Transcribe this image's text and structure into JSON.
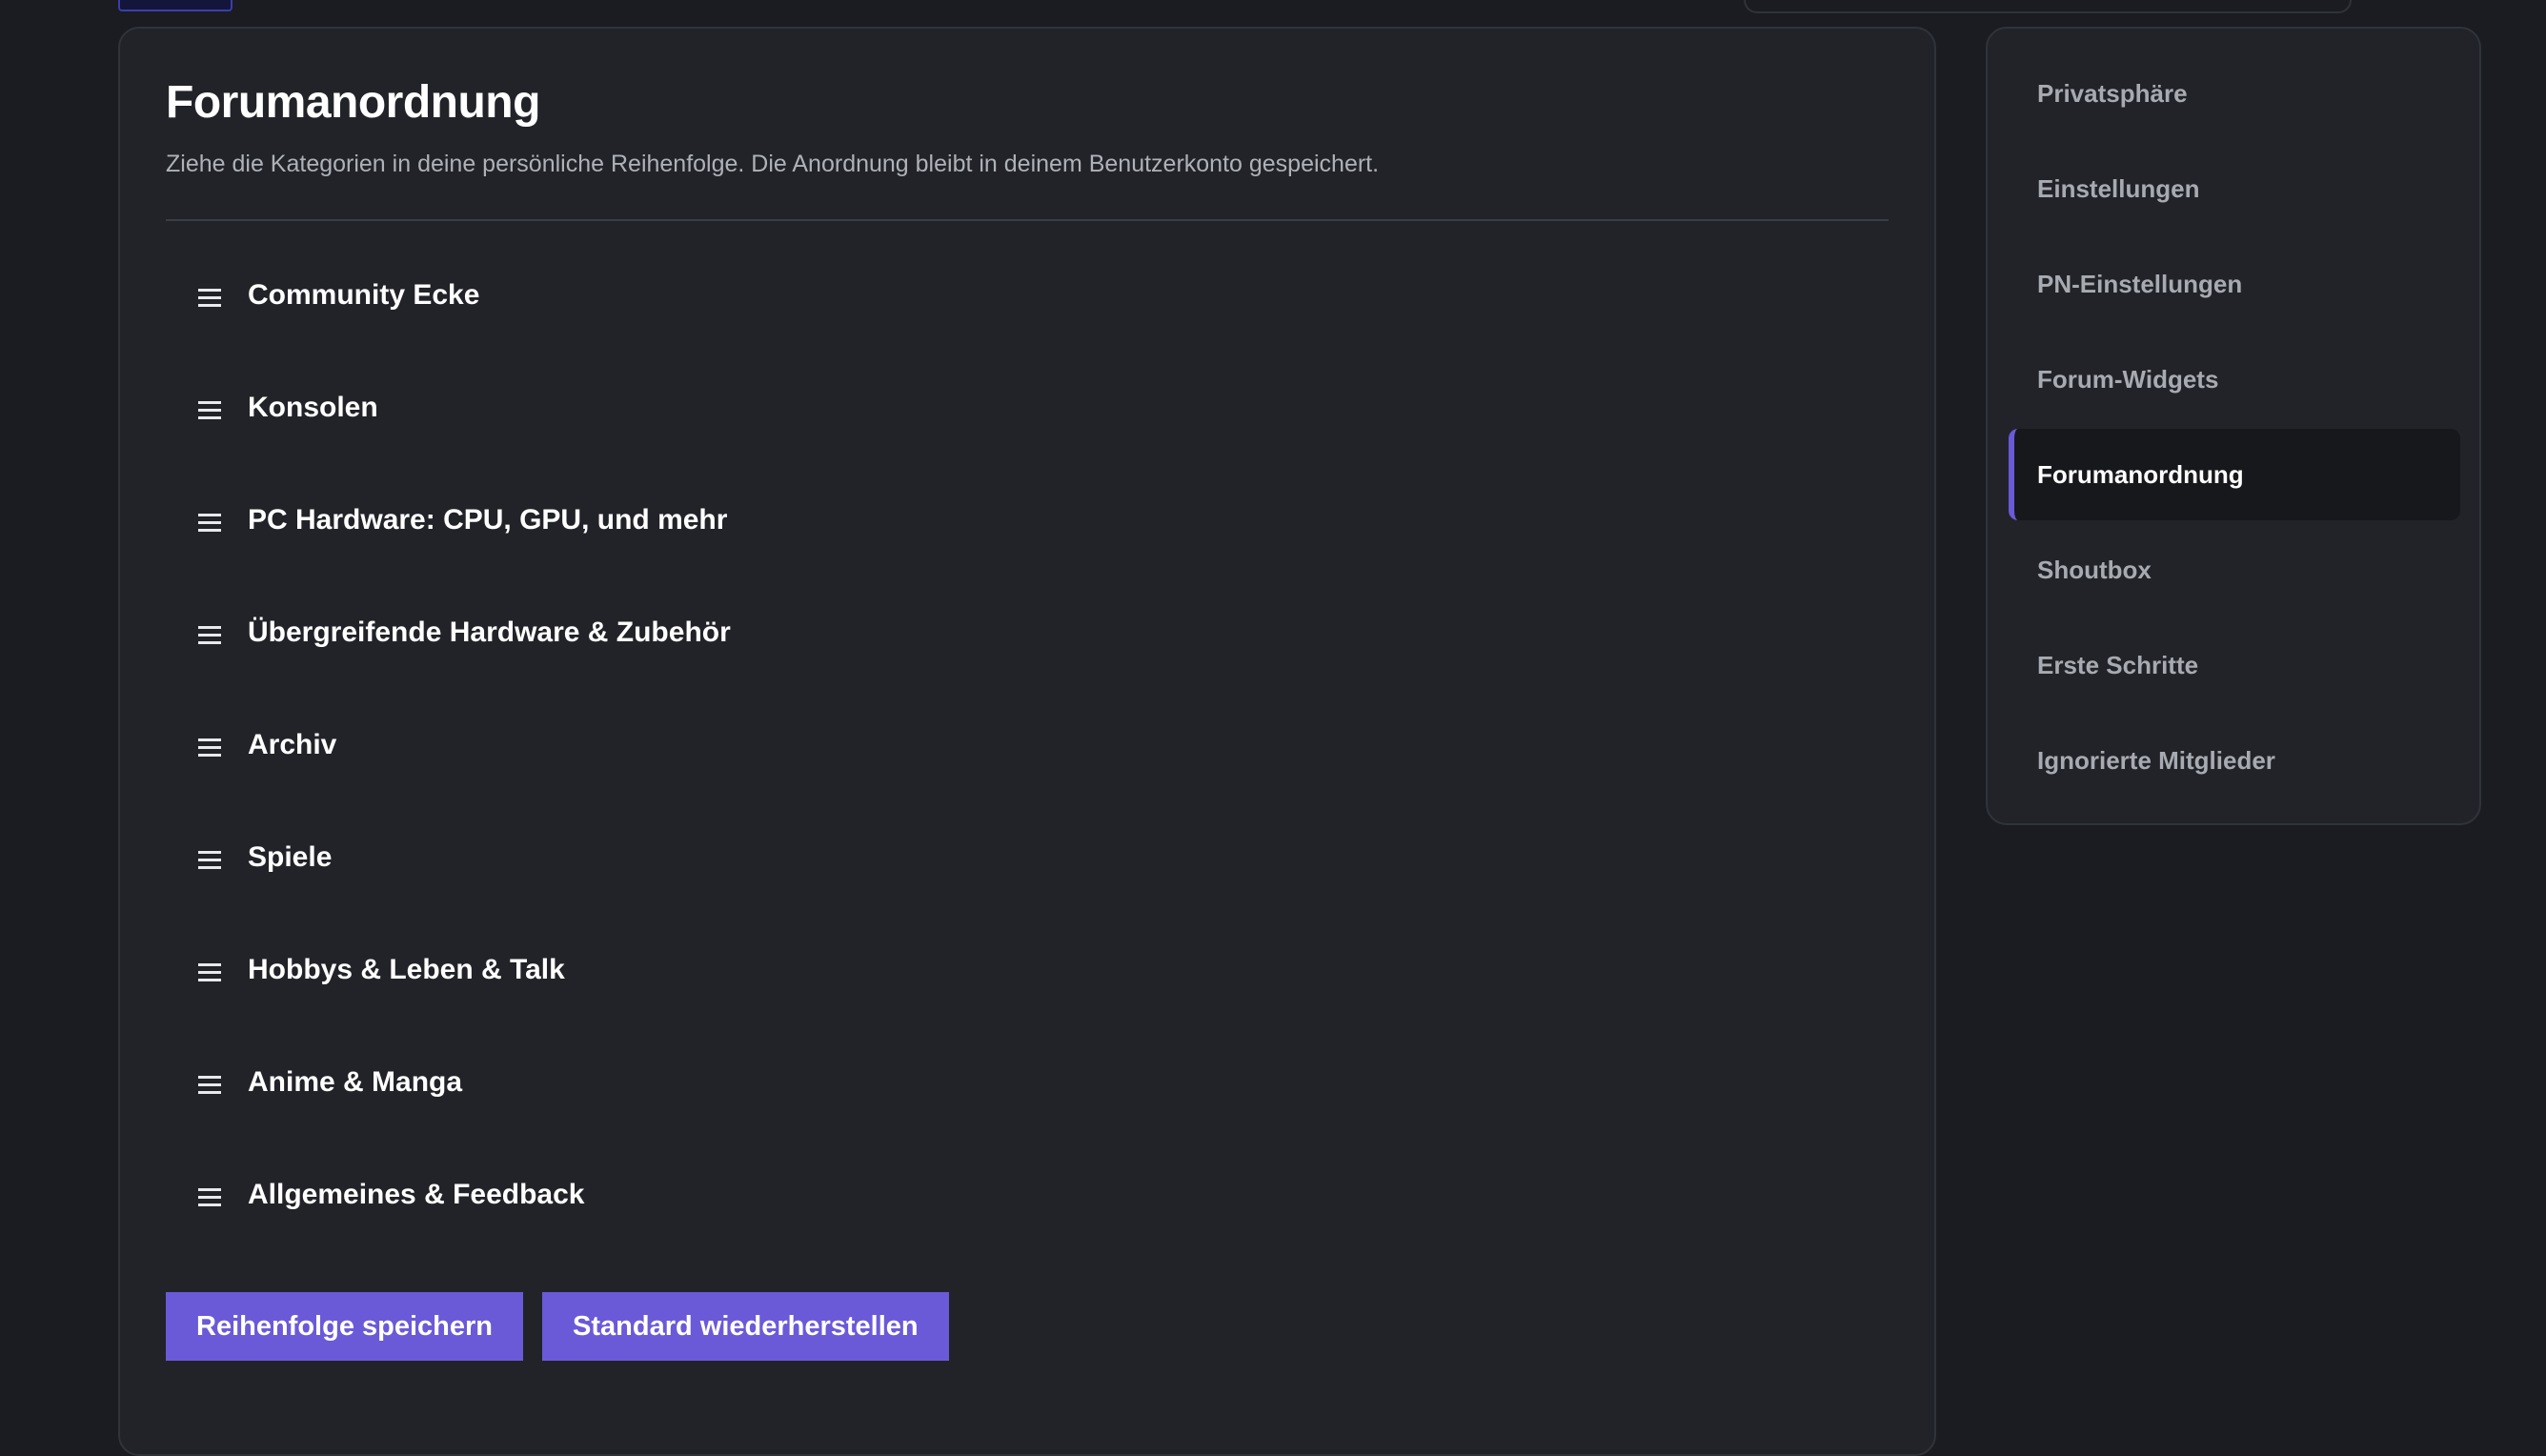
{
  "page": {
    "title": "Forumanordnung",
    "description": "Ziehe die Kategorien in deine persönliche Reihenfolge. Die Anordnung bleibt in deinem Benutzerkonto gespeichert."
  },
  "categories": [
    {
      "label": "Community Ecke",
      "icon": "drag-handle-icon"
    },
    {
      "label": "Konsolen",
      "icon": "drag-handle-icon"
    },
    {
      "label": "PC Hardware: CPU, GPU, und mehr",
      "icon": "drag-handle-icon"
    },
    {
      "label": "Übergreifende Hardware & Zubehör",
      "icon": "drag-handle-icon"
    },
    {
      "label": "Archiv",
      "icon": "drag-handle-icon"
    },
    {
      "label": "Spiele",
      "icon": "drag-handle-icon"
    },
    {
      "label": "Hobbys & Leben & Talk",
      "icon": "drag-handle-icon"
    },
    {
      "label": "Anime & Manga",
      "icon": "drag-handle-icon"
    },
    {
      "label": "Allgemeines & Feedback",
      "icon": "drag-handle-icon"
    }
  ],
  "buttons": {
    "save": "Reihenfolge speichern",
    "reset": "Standard wiederherstellen"
  },
  "sidebar": {
    "items": [
      {
        "label": "Privatsphäre",
        "active": false
      },
      {
        "label": "Einstellungen",
        "active": false
      },
      {
        "label": "PN-Einstellungen",
        "active": false
      },
      {
        "label": "Forum-Widgets",
        "active": false
      },
      {
        "label": "Forumanordnung",
        "active": true
      },
      {
        "label": "Shoutbox",
        "active": false
      },
      {
        "label": "Erste Schritte",
        "active": false
      },
      {
        "label": "Ignorierte Mitglieder",
        "active": false
      }
    ]
  },
  "colors": {
    "background": "#1a1c21",
    "panel": "#212328",
    "accent": "#6a5ad8",
    "text_primary": "#ffffff",
    "text_muted": "#a7aab1"
  }
}
